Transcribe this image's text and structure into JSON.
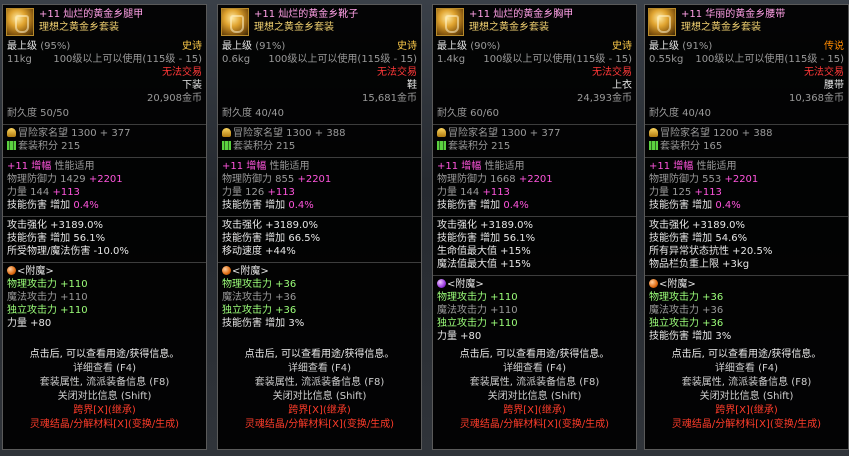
{
  "cards": [
    {
      "name": "+11 灿烂的黄金乡腿甲",
      "set_name": "理想之黄金乡套装",
      "level_label": "最上级",
      "quality": "(95%)",
      "rarity": "史诗",
      "weight": "11kg",
      "use_level": "100级以上可以使用(115级 - 15)",
      "trade": "无法交易",
      "slot": "下装",
      "price": "20,908金币",
      "durability": "耐久度 50/50",
      "fame": "冒险家名望 1300 + 377",
      "set_points": "套装积分 215",
      "enhance_prefix": "+11",
      "enhance_tag": "增幅",
      "enhance_suffix": "性能适用",
      "stat1_label": "物理防御力 1429",
      "stat1_bonus": "+2201",
      "stat2_label": "力量 144",
      "stat2_bonus": "+113",
      "skill_dmg": "技能伤害 增加",
      "skill_pct": "0.4%",
      "attrs": [
        "攻击强化 +3189.0%",
        "技能伤害 增加 56.1%",
        "所受物理/魔法伤害 -10.0%"
      ],
      "enchant_title": "<附魔>",
      "enchant_lines": [
        {
          "text": "物理攻击力 +110",
          "dim": false
        },
        {
          "text": "魔法攻击力 +110",
          "dim": true
        },
        {
          "text": "独立攻击力 +110",
          "dim": false
        },
        {
          "text": "力量 +80",
          "dim": false
        }
      ]
    },
    {
      "name": "+11 灿烂的黄金乡靴子",
      "set_name": "理想之黄金乡套装",
      "level_label": "最上级",
      "quality": "(91%)",
      "rarity": "史诗",
      "weight": "0.6kg",
      "use_level": "100级以上可以使用(115级 - 15)",
      "trade": "无法交易",
      "slot": "鞋",
      "price": "15,681金币",
      "durability": "耐久度 40/40",
      "fame": "冒险家名望 1300 + 388",
      "set_points": "套装积分 215",
      "enhance_prefix": "+11",
      "enhance_tag": "增幅",
      "enhance_suffix": "性能适用",
      "stat1_label": "物理防御力 855",
      "stat1_bonus": "+2201",
      "stat2_label": "力量 126",
      "stat2_bonus": "+113",
      "skill_dmg": "技能伤害 增加",
      "skill_pct": "0.4%",
      "attrs": [
        "攻击强化 +3189.0%",
        "技能伤害 增加 66.5%",
        "移动速度 +44%"
      ],
      "enchant_title": "<附魔>",
      "enchant_lines": [
        {
          "text": "物理攻击力 +36",
          "dim": false
        },
        {
          "text": "魔法攻击力 +36",
          "dim": true
        },
        {
          "text": "独立攻击力 +36",
          "dim": false
        },
        {
          "text": "技能伤害 增加 3%",
          "dim": false
        }
      ]
    },
    {
      "name": "+11 灿烂的黄金乡胸甲",
      "set_name": "理想之黄金乡套装",
      "level_label": "最上级",
      "quality": "(90%)",
      "rarity": "史诗",
      "weight": "1.4kg",
      "use_level": "100级以上可以使用(115级 - 15)",
      "trade": "无法交易",
      "slot": "上衣",
      "price": "24,393金币",
      "durability": "耐久度 60/60",
      "fame": "冒险家名望 1300 + 377",
      "set_points": "套装积分 215",
      "enhance_prefix": "+11",
      "enhance_tag": "增幅",
      "enhance_suffix": "性能适用",
      "stat1_label": "物理防御力 1668",
      "stat1_bonus": "+2201",
      "stat2_label": "力量 144",
      "stat2_bonus": "+113",
      "skill_dmg": "技能伤害 增加",
      "skill_pct": "0.4%",
      "attrs": [
        "攻击强化 +3189.0%",
        "技能伤害 增加 56.1%",
        "生命值最大值 +15%",
        "魔法值最大值 +15%"
      ],
      "enchant_title": "<附魔>",
      "enchant_lines": [
        {
          "text": "物理攻击力 +110",
          "dim": false
        },
        {
          "text": "魔法攻击力 +110",
          "dim": true
        },
        {
          "text": "独立攻击力 +110",
          "dim": false
        },
        {
          "text": "力量 +80",
          "dim": false
        }
      ]
    },
    {
      "name": "+11 华丽的黄金乡腰带",
      "set_name": "理想之黄金乡套装",
      "level_label": "最上级",
      "quality": "(91%)",
      "rarity": "传说",
      "weight": "0.55kg",
      "use_level": "100级以上可以使用(115级 - 15)",
      "trade": "无法交易",
      "slot": "腰带",
      "price": "10,368金币",
      "durability": "耐久度 40/40",
      "fame": "冒险家名望 1200 + 388",
      "set_points": "套装积分 165",
      "enhance_prefix": "+11",
      "enhance_tag": "增幅",
      "enhance_suffix": "性能适用",
      "stat1_label": "物理防御力 553",
      "stat1_bonus": "+2201",
      "stat2_label": "力量 125",
      "stat2_bonus": "+113",
      "skill_dmg": "技能伤害 增加",
      "skill_pct": "0.4%",
      "attrs": [
        "攻击强化 +3189.0%",
        "技能伤害 增加 54.6%",
        "所有异常状态抗性 +20.5%",
        "物品栏负重上限 +3kg"
      ],
      "enchant_title": "<附魔>",
      "enchant_lines": [
        {
          "text": "物理攻击力 +36",
          "dim": false
        },
        {
          "text": "魔法攻击力 +36",
          "dim": true
        },
        {
          "text": "独立攻击力 +36",
          "dim": false
        },
        {
          "text": "技能伤害 增加 3%",
          "dim": false
        }
      ]
    }
  ],
  "footer": {
    "click_hint": "点击后, 可以查看用途/获得信息。",
    "detail": "详细查看 (F4)",
    "set_info": "套装属性, 流派装备信息 (F8)",
    "compare": "关闭对比信息 (Shift)",
    "crossworld": "跨界[X](继承)",
    "soul": "灵魂结晶/分解材料[X](变换/生成)"
  },
  "colors": {
    "name": "#ffa0e6",
    "set": "#f0d070",
    "epic": "#ffcc4a",
    "legend": "#ff8a00",
    "enchant_green": "#9cff7a",
    "red": "#ff3838"
  }
}
